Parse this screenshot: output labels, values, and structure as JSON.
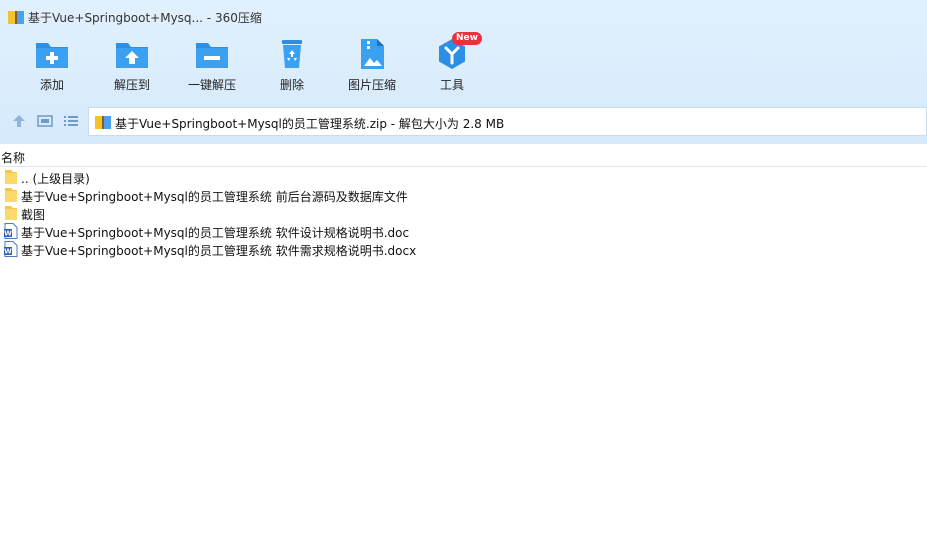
{
  "window": {
    "title": "基于Vue+Springboot+Mysq... - 360压缩"
  },
  "toolbar": {
    "items": [
      {
        "label": "添加",
        "icon": "add-folder-icon"
      },
      {
        "label": "解压到",
        "icon": "extract-to-icon"
      },
      {
        "label": "一键解压",
        "icon": "one-click-extract-icon"
      },
      {
        "label": "删除",
        "icon": "recycle-bin-icon"
      },
      {
        "label": "图片压缩",
        "icon": "image-compress-icon"
      },
      {
        "label": "工具",
        "icon": "tools-icon",
        "badge": "New"
      }
    ]
  },
  "path": {
    "text": "基于Vue+Springboot+Mysql的员工管理系统.zip - 解包大小为 2.8 MB"
  },
  "list": {
    "column_name": "名称",
    "files": [
      {
        "name": ".. (上级目录)",
        "type": "folder"
      },
      {
        "name": "基于Vue+Springboot+Mysql的员工管理系统 前后台源码及数据库文件",
        "type": "folder"
      },
      {
        "name": "截图",
        "type": "folder"
      },
      {
        "name": "基于Vue+Springboot+Mysql的员工管理系统 软件设计规格说明书.doc",
        "type": "word"
      },
      {
        "name": "基于Vue+Springboot+Mysql的员工管理系统 软件需求规格说明书.docx",
        "type": "word"
      }
    ]
  },
  "colors": {
    "accent": "#2c8fe6",
    "badge": "#e8333a",
    "toolbar_bg": "#dbecfc"
  }
}
